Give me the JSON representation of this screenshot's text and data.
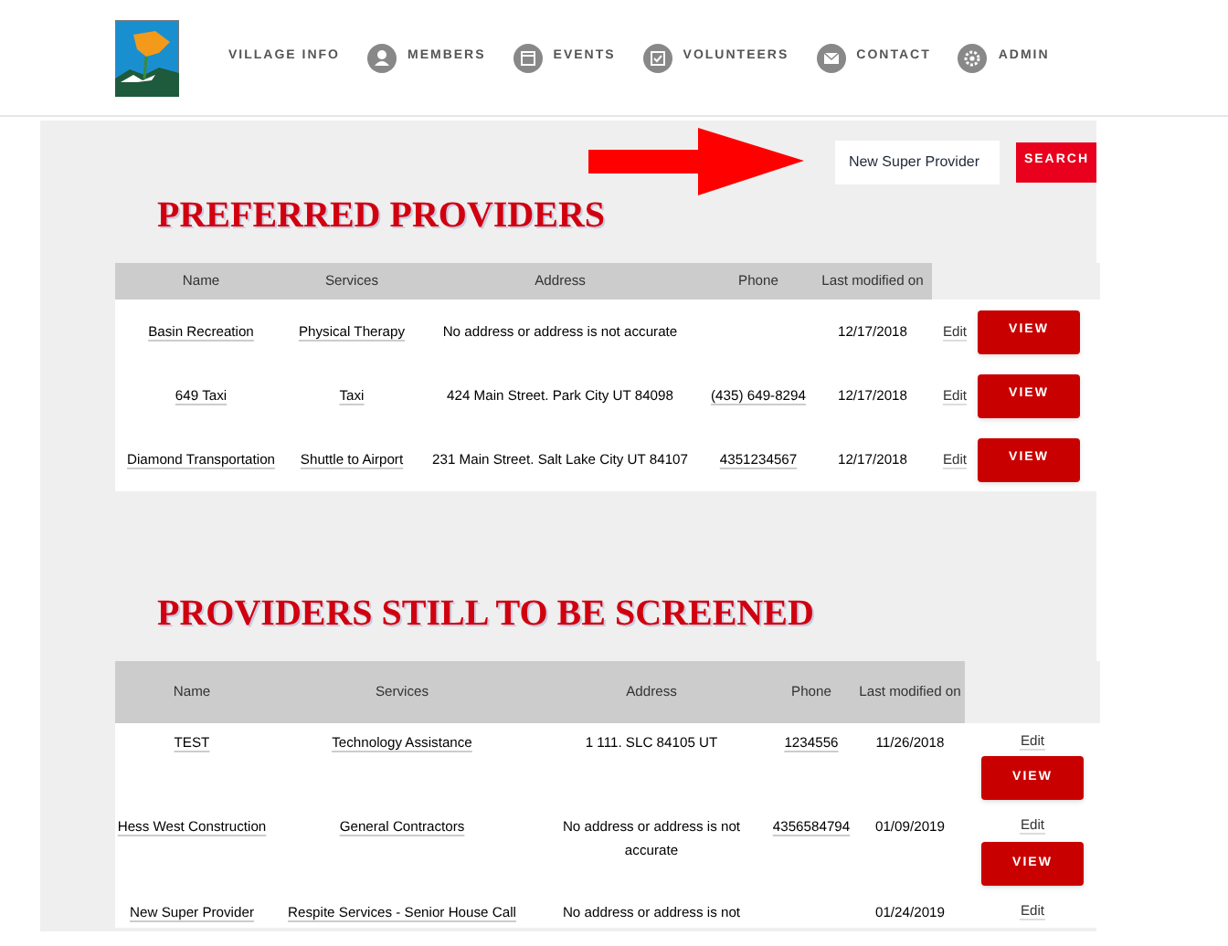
{
  "nav": [
    {
      "label": "VILLAGE INFO",
      "kind": "plain"
    },
    {
      "label": "MEMBERS",
      "kind": "person"
    },
    {
      "label": "EVENTS",
      "kind": "calendar"
    },
    {
      "label": "VOLUNTEERS",
      "kind": "check"
    },
    {
      "label": "CONTACT",
      "kind": "mail"
    },
    {
      "label": "ADMIN",
      "kind": "gear"
    }
  ],
  "search": {
    "value": "New Super Provider",
    "button": "SEARCH"
  },
  "sections": [
    {
      "title": "PREFERRED PROVIDERS",
      "columns": [
        "Name",
        "Services",
        "Address",
        "Phone",
        "Last modified on"
      ],
      "rows": [
        {
          "name": "Basin Recreation",
          "services": "Physical Therapy",
          "address": "No address or address is not accurate",
          "phone": "",
          "modified": "12/17/2018",
          "edit": "Edit",
          "view": "VIEW"
        },
        {
          "name": "649 Taxi",
          "services": "Taxi",
          "address": "424 Main Street. Park City UT 84098",
          "phone": "(435) 649-8294",
          "modified": "12/17/2018",
          "edit": "Edit",
          "view": "VIEW"
        },
        {
          "name": "Diamond Transportation",
          "services": "Shuttle to Airport",
          "address": "231 Main Street. Salt Lake City UT 84107",
          "phone": "4351234567",
          "modified": "12/17/2018",
          "edit": "Edit",
          "view": "VIEW"
        }
      ]
    },
    {
      "title": "PROVIDERS STILL TO BE SCREENED",
      "columns": [
        "Name",
        "Services",
        "Address",
        "Phone",
        "Last modified on"
      ],
      "rows": [
        {
          "name": "TEST",
          "services": "Technology Assistance",
          "address": "1 111. SLC 84105 UT",
          "phone": "1234556",
          "modified": "11/26/2018",
          "edit": "Edit",
          "view": "VIEW"
        },
        {
          "name": "Hess West Construction",
          "services": "General Contractors",
          "address": "No address or address is not accurate",
          "phone": "4356584794",
          "modified": "01/09/2019",
          "edit": "Edit",
          "view": "VIEW"
        },
        {
          "name": "New Super Provider",
          "services": "Respite Services - Senior House Call",
          "address": "No address or address is not",
          "phone": "",
          "modified": "01/24/2019",
          "edit": "Edit"
        }
      ]
    }
  ]
}
